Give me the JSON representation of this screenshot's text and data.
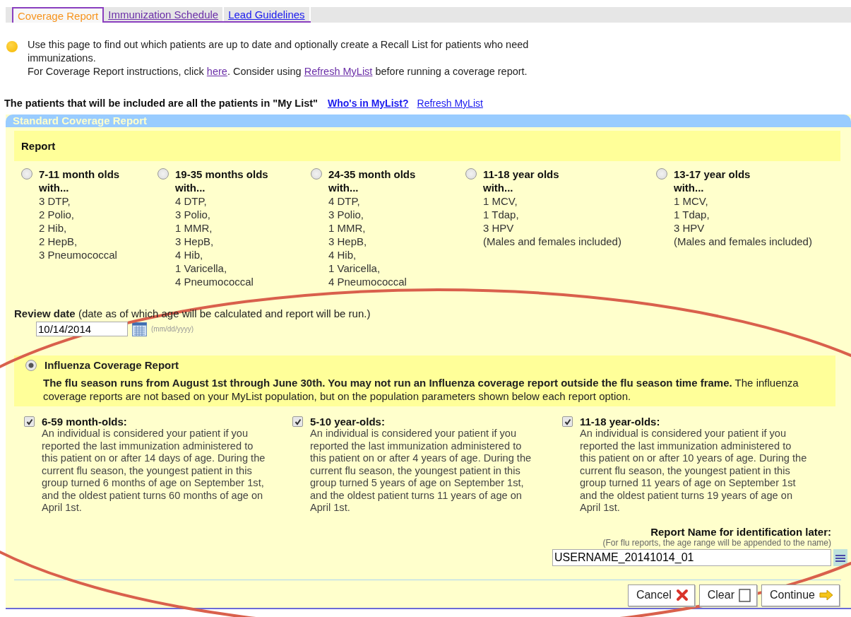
{
  "tabs": [
    {
      "label": "Coverage Report",
      "selected": true
    },
    {
      "label": "Immunization Schedule",
      "selected": false
    },
    {
      "label": "Lead Guidelines",
      "selected": false
    }
  ],
  "intro": {
    "line_1": "Use this page to find out which patients are up to date and optionally create a Recall List for patients who need immunizations.",
    "line_2": [
      {
        "kind": "text",
        "text": "For Coverage Report instructions, click "
      },
      {
        "kind": "link",
        "text": "here"
      },
      {
        "kind": "text",
        "text": ". Consider using "
      },
      {
        "kind": "link",
        "text": "Refresh MyList"
      },
      {
        "kind": "text",
        "text": " before running a coverage report."
      }
    ]
  },
  "mylist": {
    "text": "The patients that will be included are all the patients in \"My List\"",
    "links": [
      {
        "text": "Who's in MyList?",
        "bold": true
      },
      {
        "text": "Refresh MyList",
        "bold": false
      }
    ]
  },
  "panel": {
    "title": "Standard Coverage Report",
    "report": {
      "heading": "Report",
      "options": [
        {
          "title": "7-11 month olds",
          "subtitle": "with...",
          "items": [
            "3 DTP,",
            "2 Polio,",
            "2 Hib,",
            "2 HepB,",
            "3 Pneumococcal"
          ],
          "selected": false
        },
        {
          "title": "19-35 months olds",
          "subtitle": "with...",
          "items": [
            "4 DTP,",
            "3 Polio,",
            "1 MMR,",
            "3 HepB,",
            "4 Hib,",
            "1 Varicella,",
            "4 Pneumococcal"
          ],
          "selected": false
        },
        {
          "title": "24-35 month olds",
          "subtitle": "with...",
          "items": [
            "4 DTP,",
            "3 Polio,",
            "1 MMR,",
            "3 HepB,",
            "4 Hib,",
            "1 Varicella,",
            "4 Pneumococcal"
          ],
          "selected": false
        },
        {
          "title": "11-18 year olds",
          "subtitle": "with...",
          "items": [
            "1 MCV,",
            "1 Tdap,",
            "3 HPV",
            "(Males and females included)"
          ],
          "selected": false
        },
        {
          "title": "13-17 year olds",
          "subtitle": "with...",
          "items": [
            "1 MCV,",
            "1 Tdap,",
            "3 HPV",
            "(Males and females included)"
          ],
          "selected": false
        }
      ]
    },
    "review_date": {
      "label": "**Review date** (date as of which age will be calculated and report will be run.)",
      "value": "10/14/2014",
      "format_hint": "(mm/dd/yyyy)"
    },
    "influenza": {
      "title": "Influenza Coverage Report",
      "selected": true,
      "notice": "**The flu season runs from August 1st through June 30th. You may not run an Influenza coverage report outside the flu season time frame.** The influenza coverage reports are not based on your MyList population, but on the population parameters shown below each report option.",
      "groups": [
        {
          "label": "6-59 month-olds:",
          "checked": true,
          "description": "An individual is considered your patient if you reported the last immunization administered to this patient on or after 14 days of age. During the current flu season, the youngest patient in this group turned 6 months of age on September 1st, and the oldest patient turns 60 months of age on April 1st."
        },
        {
          "label": "5-10 year-olds:",
          "checked": true,
          "description": "An individual is considered your patient if you reported the last immunization administered to this patient on or after 4 years of age. During the current flu season, the youngest patient in this group turned 5 years of age on September 1st, and the oldest patient turns 11 years of age on April 1st."
        },
        {
          "label": "11-18 year-olds:",
          "checked": true,
          "description": "An individual is considered your patient if you reported the last immunization administered to this patient on or after 10 years of age. During the current flu season, the youngest patient in this group turned 11 years of age on September 1st and the oldest patient turns 19 years of age on April 1st."
        }
      ]
    },
    "report_name": {
      "label": "Report Name for identification later:",
      "hint": "(For flu reports, the age range will be appended to the name)",
      "value": "USERNAME_20141014_01"
    },
    "buttons": [
      {
        "label": "Cancel",
        "kind": "cancel"
      },
      {
        "label": "Clear",
        "kind": "clear"
      },
      {
        "label": "Continue",
        "kind": "continue"
      }
    ]
  },
  "annotation_oval": true
}
